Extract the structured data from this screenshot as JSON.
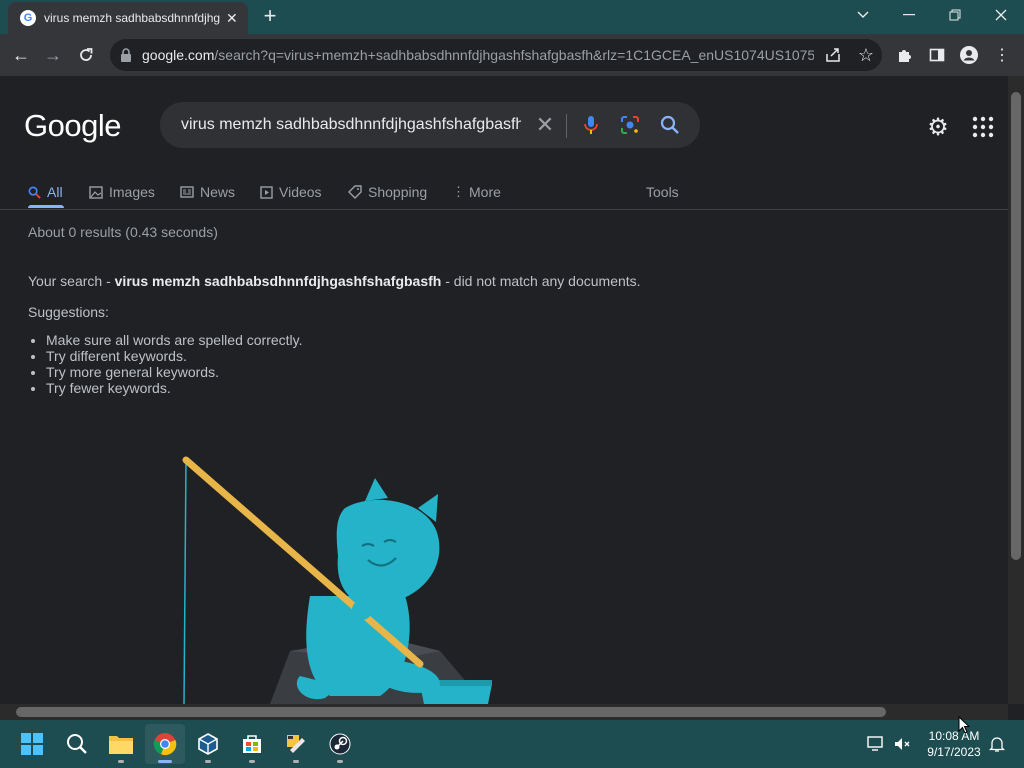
{
  "browser": {
    "tab_title": "virus memzh sadhbabsdhnnfdjhgashfshafgbasfh - Google Search",
    "url_domain": "google.com",
    "url_rest": "/search?q=virus+memzh+sadhbabsdhnnfdjhgashfshafgbasfh&rlz=1C1GCEA_enUS1074US1075..."
  },
  "search": {
    "logo": "Google",
    "query": "virus memzh sadhbabsdhnnfdjhgashfshafgbasfh",
    "tabs": [
      {
        "label": "All",
        "icon": "search-icon"
      },
      {
        "label": "Images",
        "icon": "image-icon"
      },
      {
        "label": "News",
        "icon": "news-icon"
      },
      {
        "label": "Videos",
        "icon": "video-icon"
      },
      {
        "label": "Shopping",
        "icon": "tag-icon"
      },
      {
        "label": "More",
        "icon": "more-vert-icon"
      }
    ],
    "tools": "Tools",
    "stats": "About 0 results (0.43 seconds)",
    "no_match_prefix": "Your search - ",
    "no_match_query": "virus memzh sadhbabsdhnnfdjhgashfshafgbasfh",
    "no_match_suffix": " - did not match any documents.",
    "suggestions_label": "Suggestions:",
    "suggestions": [
      "Make sure all words are spelled correctly.",
      "Try different keywords.",
      "Try more general keywords.",
      "Try fewer keywords."
    ]
  },
  "taskbar": {
    "time": "10:08 AM",
    "date": "9/17/2023"
  },
  "colors": {
    "accent": "#8ab4f8",
    "titlebar": "#1d4d50",
    "mascot": "#24b3c8"
  }
}
